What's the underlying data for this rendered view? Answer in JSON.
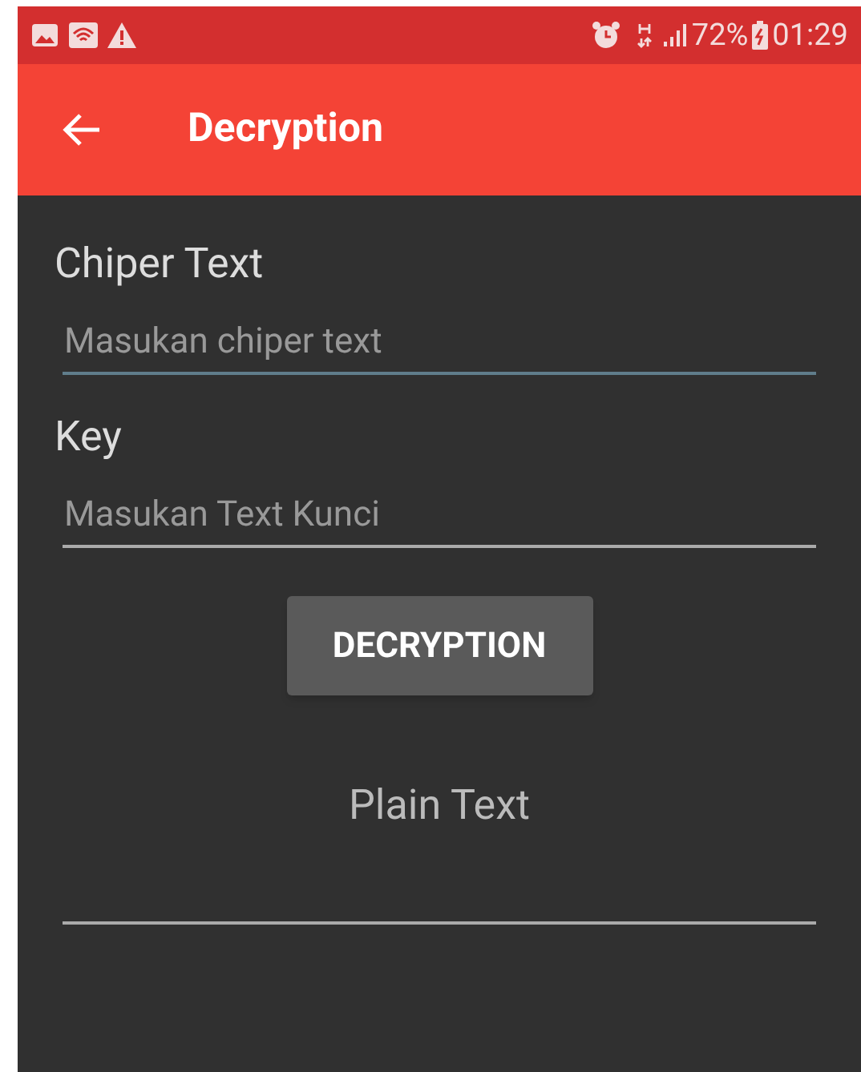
{
  "status_bar": {
    "battery": "72%",
    "time": "01:29"
  },
  "app_bar": {
    "title": "Decryption"
  },
  "form": {
    "fields": [
      {
        "label": "Chiper Text",
        "placeholder": "Masukan chiper text",
        "focused": true
      },
      {
        "label": "Key",
        "placeholder": "Masukan Text Kunci",
        "focused": false
      }
    ],
    "button": "DECRYPTION",
    "output_label": "Plain Text"
  }
}
